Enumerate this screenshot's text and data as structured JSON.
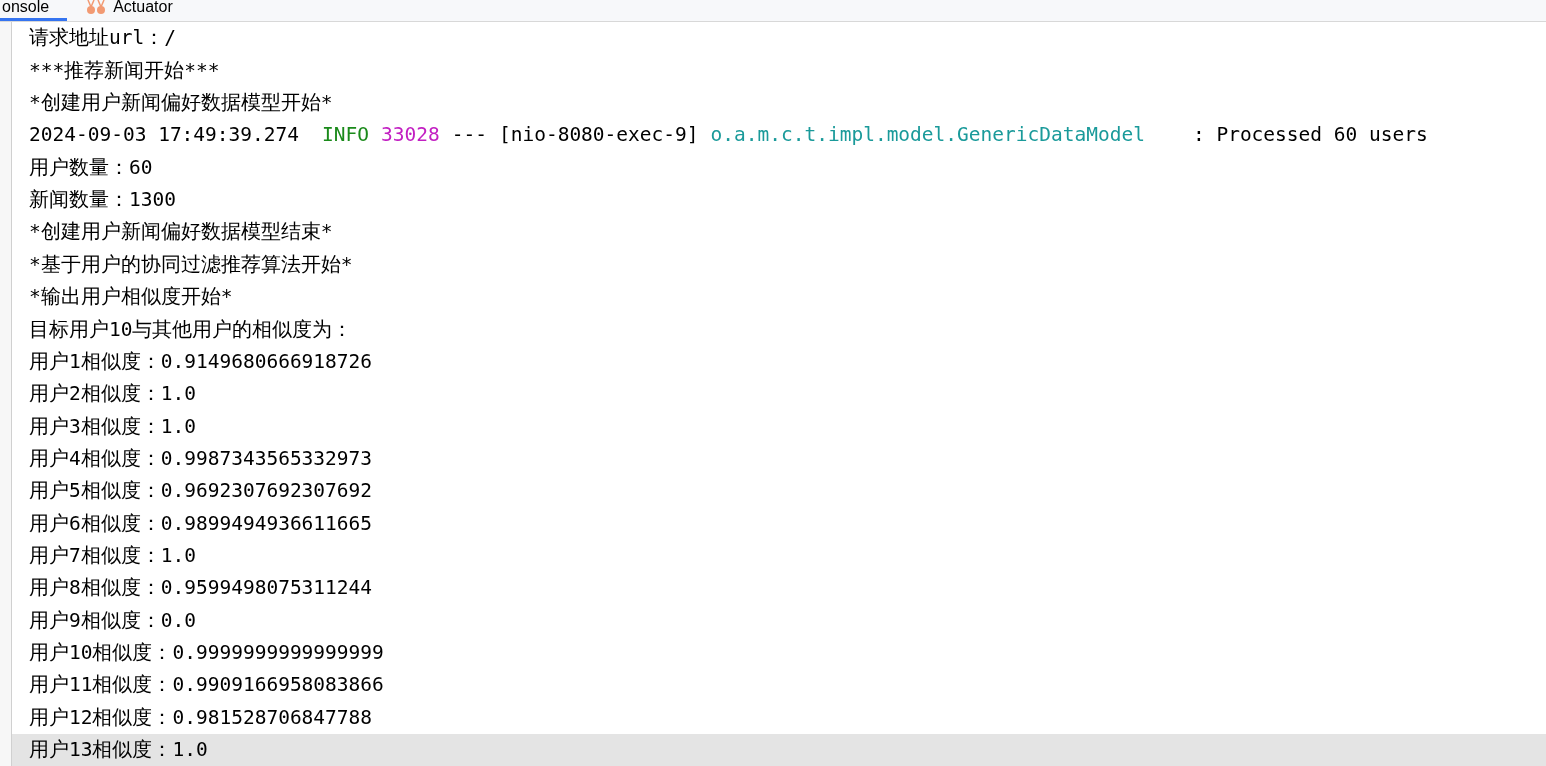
{
  "tabs": [
    {
      "label": "onsole",
      "selected": true,
      "icon": false
    },
    {
      "label": "Actuator",
      "selected": false,
      "icon": true
    }
  ],
  "console": {
    "lines": [
      {
        "kind": "text",
        "text": "请求地址url：/",
        "current": false
      },
      {
        "kind": "text",
        "text": "***推荐新闻开始***",
        "current": false
      },
      {
        "kind": "text",
        "text": "*创建用户新闻偏好数据模型开始*",
        "current": false
      },
      {
        "kind": "log",
        "current": false,
        "segments": [
          {
            "kind": "timestamp",
            "text": "2024-09-03 17:49:39.274"
          },
          {
            "kind": "level",
            "text": "INFO"
          },
          {
            "kind": "pid",
            "text": "33028"
          },
          {
            "kind": "plain",
            "text": "---"
          },
          {
            "kind": "plain",
            "text": "[nio-8080-exec-9]"
          },
          {
            "kind": "logger",
            "text": "o.a.m.c.t.impl.model.GenericDataModel"
          },
          {
            "kind": "message",
            "text": ": Processed 60 users"
          }
        ]
      },
      {
        "kind": "text",
        "text": "用户数量：60",
        "current": false
      },
      {
        "kind": "text",
        "text": "新闻数量：1300",
        "current": false
      },
      {
        "kind": "text",
        "text": "*创建用户新闻偏好数据模型结束*",
        "current": false
      },
      {
        "kind": "text",
        "text": "*基于用户的协同过滤推荐算法开始*",
        "current": false
      },
      {
        "kind": "text",
        "text": "*输出用户相似度开始*",
        "current": false
      },
      {
        "kind": "text",
        "text": "目标用户10与其他用户的相似度为：",
        "current": false
      },
      {
        "kind": "text",
        "text": "用户1相似度：0.9149680666918726",
        "current": false
      },
      {
        "kind": "text",
        "text": "用户2相似度：1.0",
        "current": false
      },
      {
        "kind": "text",
        "text": "用户3相似度：1.0",
        "current": false
      },
      {
        "kind": "text",
        "text": "用户4相似度：0.9987343565332973",
        "current": false
      },
      {
        "kind": "text",
        "text": "用户5相似度：0.9692307692307692",
        "current": false
      },
      {
        "kind": "text",
        "text": "用户6相似度：0.9899494936611665",
        "current": false
      },
      {
        "kind": "text",
        "text": "用户7相似度：1.0",
        "current": false
      },
      {
        "kind": "text",
        "text": "用户8相似度：0.9599498075311244",
        "current": false
      },
      {
        "kind": "text",
        "text": "用户9相似度：0.0",
        "current": false
      },
      {
        "kind": "text",
        "text": "用户10相似度：0.9999999999999999",
        "current": false
      },
      {
        "kind": "text",
        "text": "用户11相似度：0.9909166958083866",
        "current": false
      },
      {
        "kind": "text",
        "text": "用户12相似度：0.981528706847788",
        "current": false
      },
      {
        "kind": "text",
        "text": "用户13相似度：1.0",
        "current": true
      }
    ]
  }
}
